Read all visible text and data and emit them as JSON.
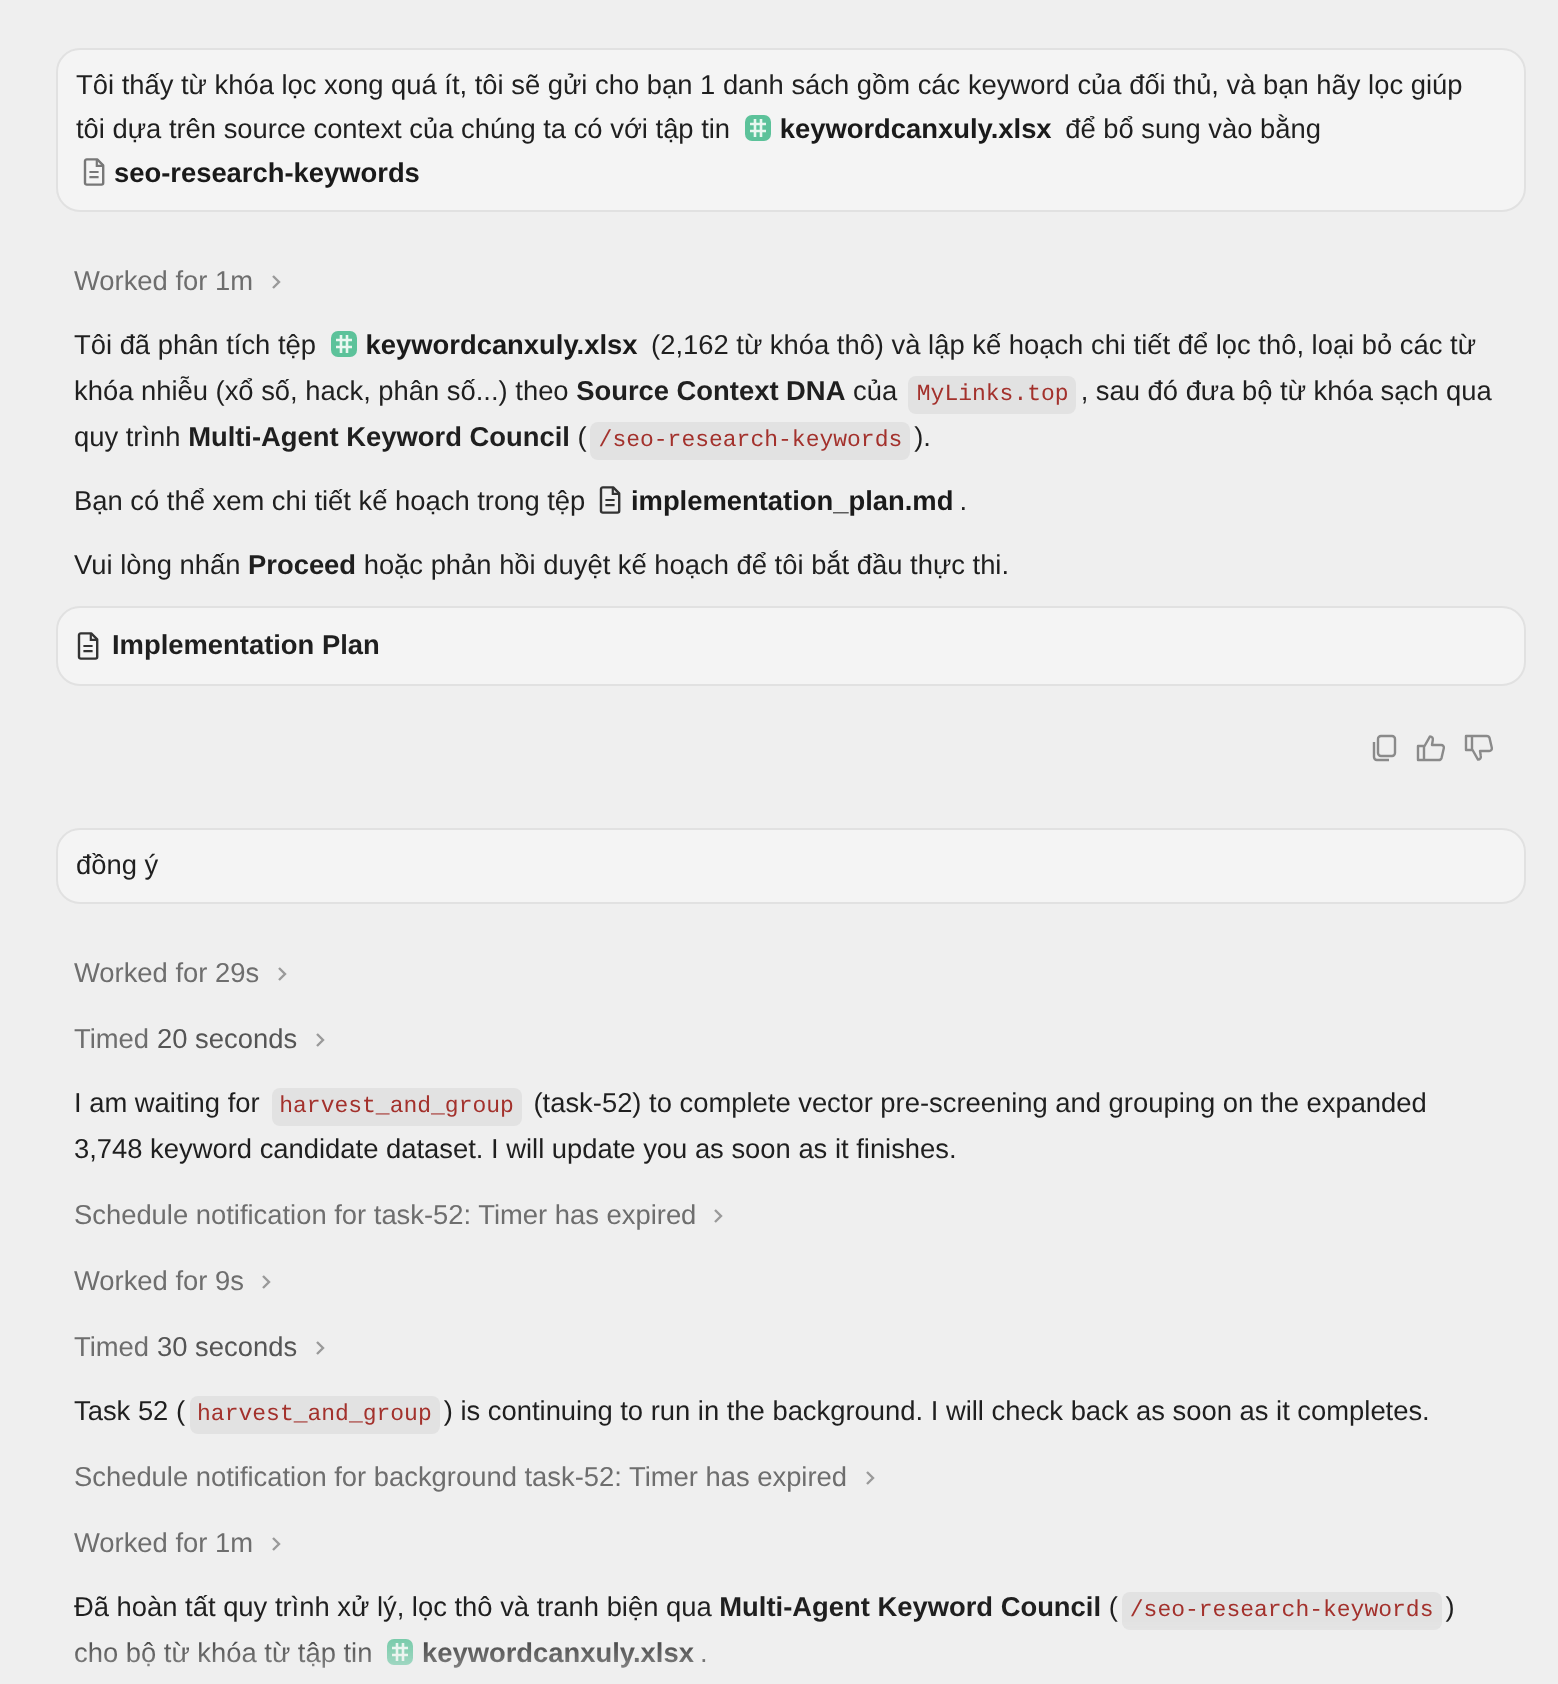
{
  "conversation": [
    {
      "kind": "user_message",
      "segments": [
        {
          "kind": "text",
          "text": "Tôi thấy từ khóa lọc xong quá ít, tôi sẽ gửi cho bạn 1 danh sách gồm các keyword của đối thủ, và bạn hãy lọc giúp tôi dựa trên source context của chúng ta có với tập tin "
        },
        {
          "kind": "spreadsheet_file",
          "text": "keywordcanxuly.xlsx"
        },
        {
          "kind": "text",
          "text": " để bổ sung vào bằng "
        },
        {
          "kind": "document_file",
          "text": "seo-research-keywords"
        }
      ]
    },
    {
      "kind": "step",
      "label": "Worked for 1m",
      "expanded": false
    },
    {
      "kind": "paragraph",
      "segments": [
        {
          "kind": "text",
          "text": "Tôi đã phân tích tệp "
        },
        {
          "kind": "spreadsheet_file",
          "text": "keywordcanxuly.xlsx"
        },
        {
          "kind": "text",
          "text": " (2,162 từ khóa thô) và lập kế hoạch chi tiết để lọc thô, loại bỏ các từ khóa nhiễu (xổ số, hack, phân số...) theo **Source Context DNA** của "
        },
        {
          "kind": "code",
          "text": "MyLinks.top"
        },
        {
          "kind": "text",
          "text": ", sau đó đưa bộ từ khóa sạch qua quy trình **Multi-Agent Keyword Council** ("
        },
        {
          "kind": "code",
          "text": "/seo-research-keywords"
        },
        {
          "kind": "text",
          "text": ")."
        }
      ]
    },
    {
      "kind": "paragraph",
      "segments": [
        {
          "kind": "text",
          "text": "Bạn có thể xem chi tiết kế hoạch trong tệp "
        },
        {
          "kind": "document_file",
          "text": "implementation_plan.md"
        },
        {
          "kind": "text",
          "text": "."
        }
      ]
    },
    {
      "kind": "paragraph",
      "segments": [
        {
          "kind": "text",
          "text": "Vui lòng nhấn **Proceed** hoặc phản hồi duyệt kế hoạch để tôi bắt đầu thực thi."
        }
      ]
    },
    {
      "kind": "artifact",
      "title": "Implementation Plan"
    },
    {
      "kind": "actions"
    },
    {
      "kind": "user_message",
      "segments": [
        {
          "kind": "text",
          "text": "đồng ý"
        }
      ]
    },
    {
      "kind": "step",
      "label": "Worked for 29s",
      "expanded": false
    },
    {
      "kind": "step",
      "label": "Timed",
      "detail": "20 seconds",
      "expanded": false
    },
    {
      "kind": "paragraph",
      "segments": [
        {
          "kind": "text",
          "text": "I am waiting for "
        },
        {
          "kind": "code",
          "text": "harvest_and_group"
        },
        {
          "kind": "text",
          "text": " (task-52) to complete vector pre-screening and grouping on the expanded 3,748 keyword candidate dataset. I will update you as soon as it finishes."
        }
      ]
    },
    {
      "kind": "step",
      "label": "Schedule notification for task-52: Timer has expired",
      "expanded": false
    },
    {
      "kind": "step",
      "label": "Worked for 9s",
      "expanded": false
    },
    {
      "kind": "step",
      "label": "Timed",
      "detail": "30 seconds",
      "expanded": false
    },
    {
      "kind": "paragraph",
      "segments": [
        {
          "kind": "text",
          "text": "Task 52 ("
        },
        {
          "kind": "code",
          "text": "harvest_and_group"
        },
        {
          "kind": "text",
          "text": ") is continuing to run in the background. I will check back as soon as it completes."
        }
      ]
    },
    {
      "kind": "step",
      "label": "Schedule notification for background task-52: Timer has expired",
      "expanded": false
    },
    {
      "kind": "step",
      "label": "Worked for 1m",
      "expanded": false
    },
    {
      "kind": "paragraph",
      "segments": [
        {
          "kind": "text",
          "text": "Đã hoàn tất quy trình xử lý, lọc thô và tranh biện qua **Multi-Agent Keyword Council** ("
        },
        {
          "kind": "code",
          "text": "/seo-research-keywords"
        },
        {
          "kind": "text",
          "text": ") cho bộ từ khóa từ tập tin "
        },
        {
          "kind": "spreadsheet_file",
          "text": "keywordcanxuly.xlsx"
        },
        {
          "kind": "text",
          "text": "."
        }
      ]
    }
  ]
}
